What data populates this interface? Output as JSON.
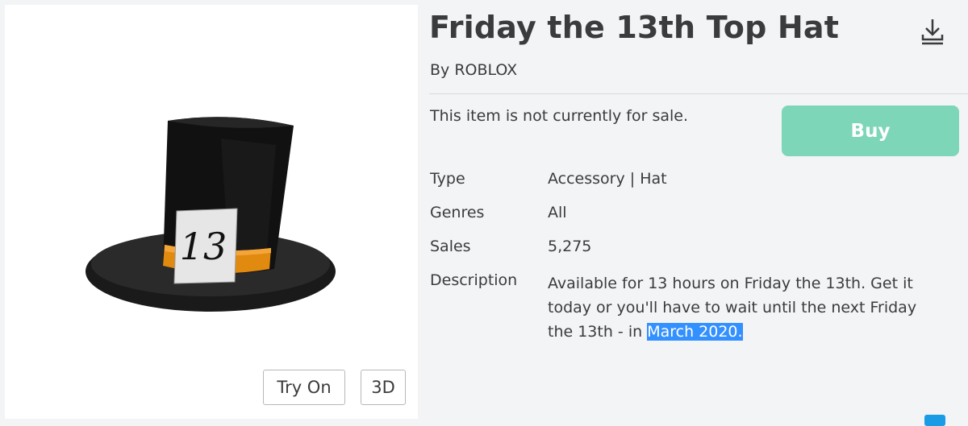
{
  "item": {
    "title": "Friday the 13th Top Hat",
    "by_prefix": "By",
    "creator": "ROBLOX",
    "sale_status": "This item is not currently for sale.",
    "buy_label": "Buy"
  },
  "thumbnail": {
    "try_on_label": "Try On",
    "view_3d_label": "3D",
    "hat_tag_number": "13"
  },
  "details": {
    "type_label": "Type",
    "type_value": "Accessory | Hat",
    "genres_label": "Genres",
    "genres_value": "All",
    "sales_label": "Sales",
    "sales_value": "5,275",
    "description_label": "Description",
    "description_line1": "Available for 13 hours on Friday the 13th. Get it",
    "description_line2": "today or you'll have to wait until the next Friday",
    "description_line3_pre": "the 13th - in ",
    "description_line3_highlight": "March 2020."
  },
  "colors": {
    "page_bg": "#f2f4f5",
    "text": "#393b3d",
    "buy_button": "#7dd6b8",
    "selection_highlight": "#3390ff"
  },
  "icons": {
    "download": "download-icon"
  }
}
